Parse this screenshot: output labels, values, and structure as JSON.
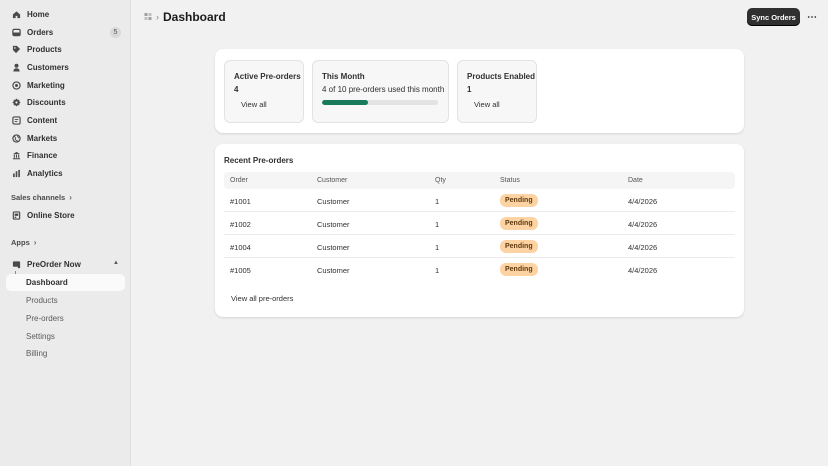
{
  "sidebar": {
    "items": [
      {
        "label": "Home",
        "icon": "home-icon"
      },
      {
        "label": "Orders",
        "icon": "orders-icon",
        "badge": "5"
      },
      {
        "label": "Products",
        "icon": "tag-icon"
      },
      {
        "label": "Customers",
        "icon": "person-icon"
      },
      {
        "label": "Marketing",
        "icon": "target-icon"
      },
      {
        "label": "Discounts",
        "icon": "discount-icon"
      },
      {
        "label": "Content",
        "icon": "content-icon"
      },
      {
        "label": "Markets",
        "icon": "globe-icon"
      },
      {
        "label": "Finance",
        "icon": "bank-icon"
      },
      {
        "label": "Analytics",
        "icon": "chart-icon"
      }
    ],
    "sales_channels_label": "Sales channels",
    "online_store": "Online Store",
    "apps_label": "Apps",
    "app_name": "PreOrder Now",
    "app_sub_items": [
      "Dashboard",
      "Products",
      "Pre-orders",
      "Settings",
      "Billing"
    ]
  },
  "header": {
    "title": "Dashboard",
    "sync_label": "Sync Orders",
    "more_label": "⋯"
  },
  "stats": {
    "active": {
      "title": "Active Pre-orders",
      "value": "4",
      "link": "View all"
    },
    "month": {
      "title": "This Month",
      "subtitle": "4 of 10 pre-orders used this month",
      "used": 4,
      "limit": 10
    },
    "products": {
      "title": "Products Enabled",
      "value": "1",
      "link": "View all"
    }
  },
  "recent": {
    "title": "Recent Pre-orders",
    "columns": [
      "Order",
      "Customer",
      "Qty",
      "Status",
      "Date"
    ],
    "rows": [
      {
        "order": "#1001",
        "customer": "Customer",
        "qty": "1",
        "status": "Pending",
        "date": "4/4/2026"
      },
      {
        "order": "#1002",
        "customer": "Customer",
        "qty": "1",
        "status": "Pending",
        "date": "4/4/2026"
      },
      {
        "order": "#1004",
        "customer": "Customer",
        "qty": "1",
        "status": "Pending",
        "date": "4/4/2026"
      },
      {
        "order": "#1005",
        "customer": "Customer",
        "qty": "1",
        "status": "Pending",
        "date": "4/4/2026"
      }
    ],
    "view_all": "View all pre-orders"
  },
  "colors": {
    "accent": "#1a7a5c",
    "pending_badge": "#fed3a3",
    "primary_button": "#303030"
  }
}
